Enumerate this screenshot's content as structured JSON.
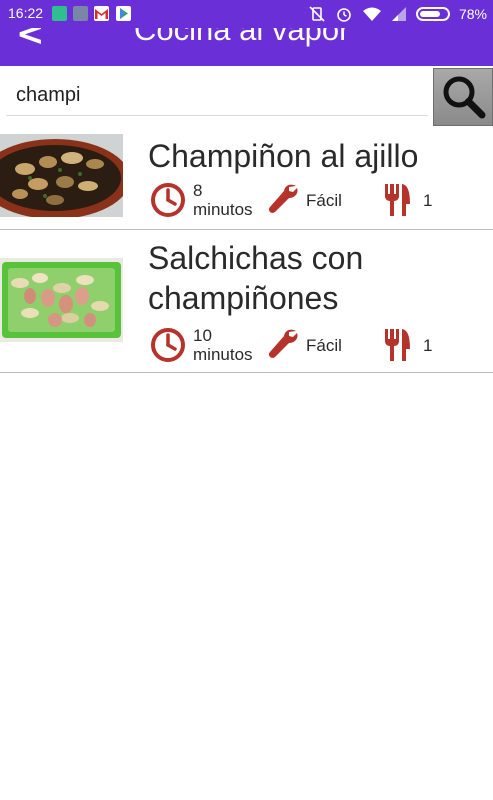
{
  "status_bar": {
    "time": "16:22",
    "battery_percent": "78%",
    "battery_level": 0.78
  },
  "app_bar": {
    "back_label": "<",
    "title": "Cocina al vapor"
  },
  "search": {
    "value": "champi"
  },
  "recipes": [
    {
      "title": "Champiñon al ajillo",
      "time_value": "8",
      "time_unit": "minutos",
      "difficulty": "Fácil",
      "servings": "1"
    },
    {
      "title_line1": "Salchichas con",
      "title_line2": "champiñones",
      "time_value": "10",
      "time_unit": "minutos",
      "difficulty": "Fácil",
      "servings": "1"
    }
  ],
  "colors": {
    "primary": "#6a2fd6",
    "icon_red": "#b5332a"
  },
  "icons": [
    "clock-icon",
    "wrench-icon",
    "cutlery-icon",
    "search-icon",
    "back-icon"
  ]
}
